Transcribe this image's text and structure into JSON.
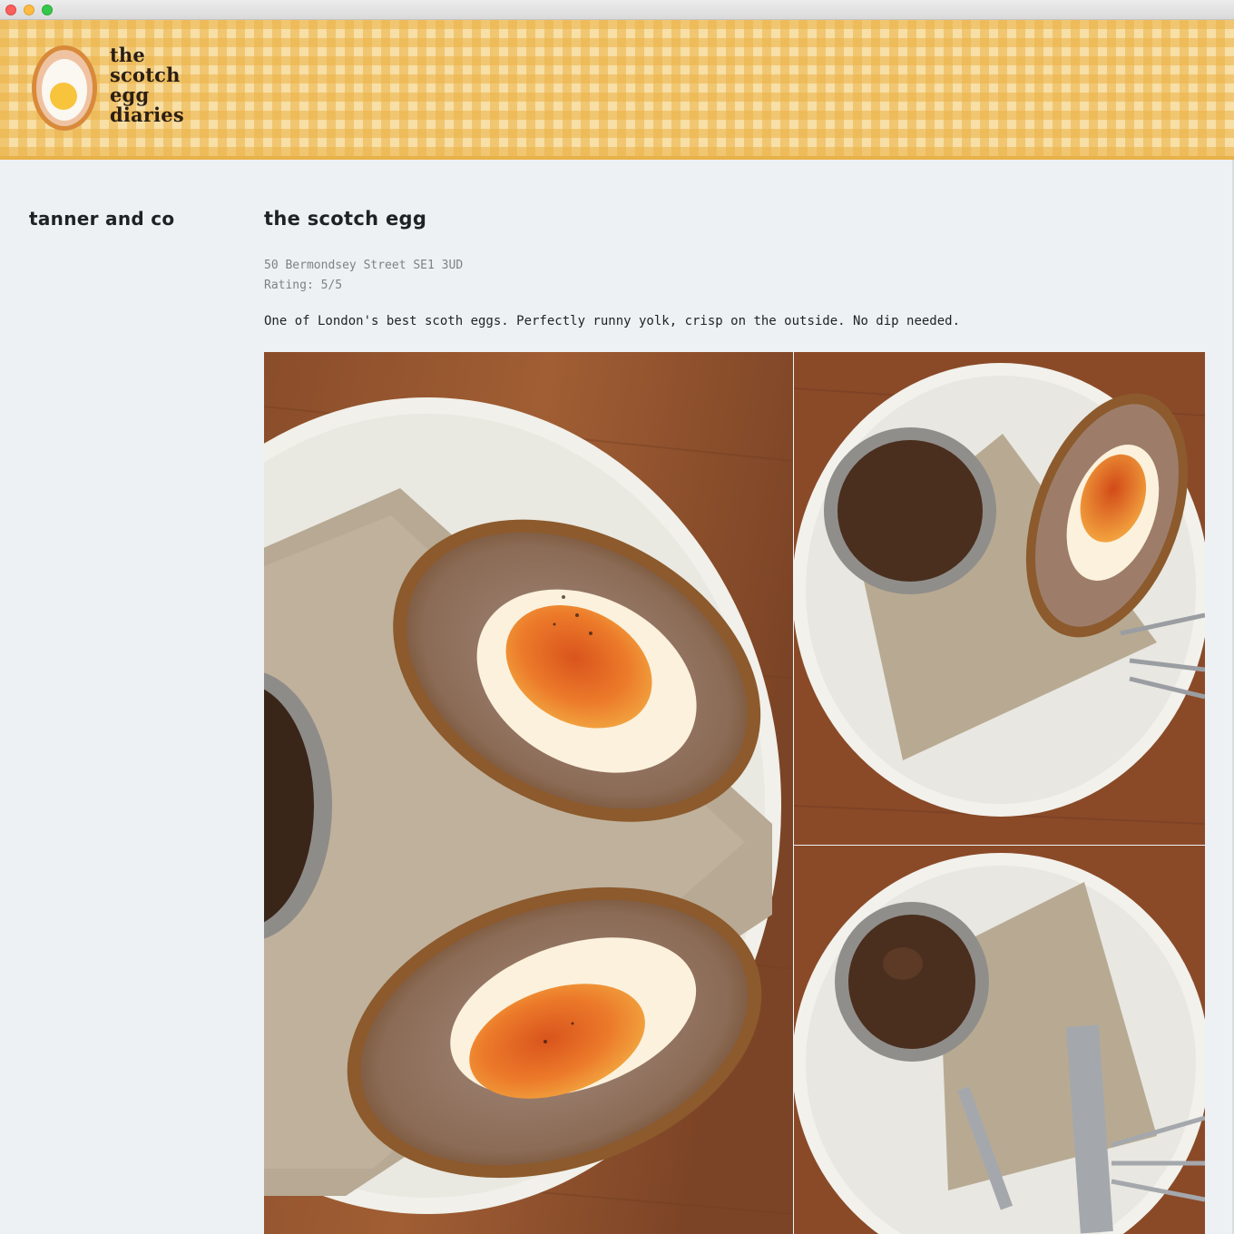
{
  "window": {
    "controls": [
      "close",
      "minimize",
      "maximize"
    ]
  },
  "header": {
    "logo_icon": "egg-icon",
    "logo_lines": [
      "the",
      "scotch",
      "egg",
      "diaries"
    ]
  },
  "sidebar": {
    "title": "tanner and co"
  },
  "post": {
    "title": "the scotch egg",
    "address": "50 Bermondsey Street SE1 3UD",
    "rating": "Rating: 5/5",
    "description": "One of London's best scoth eggs. Perfectly runny yolk, crisp on the outside. No dip needed."
  },
  "colors": {
    "header_gingham_light": "#f7dfa6",
    "header_gingham_dark": "#ecb246",
    "page_background": "#edf1f4",
    "text": "#1e2225",
    "meta_text": "#7c8286"
  }
}
